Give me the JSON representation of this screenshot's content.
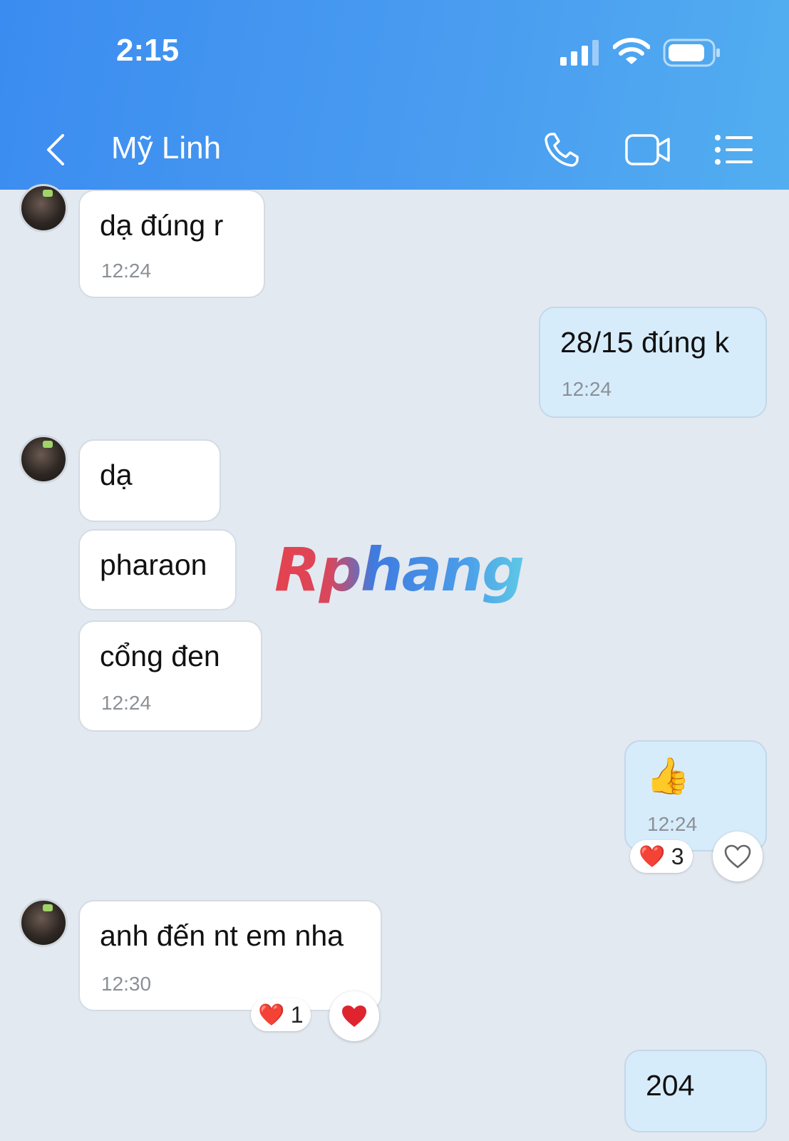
{
  "status_bar": {
    "time": "2:15"
  },
  "header": {
    "contact_name": "Mỹ Linh"
  },
  "messages": [
    {
      "side": "in",
      "text": "dạ đúng r",
      "time": "12:24"
    },
    {
      "side": "out",
      "text": "28/15 đúng k",
      "time": "12:24"
    },
    {
      "side": "in",
      "text": "dạ"
    },
    {
      "side": "in",
      "text": "pharaon"
    },
    {
      "side": "in",
      "text": "cổng đen",
      "time": "12:24"
    },
    {
      "side": "out",
      "text": "👍",
      "time": "12:24",
      "reaction": {
        "emoji": "❤️",
        "count": "3"
      }
    },
    {
      "side": "in",
      "text": "anh đến nt em nha",
      "time": "12:30",
      "reaction": {
        "emoji": "❤️",
        "count": "1"
      }
    },
    {
      "side": "out",
      "text": "204"
    }
  ],
  "watermark": "Rphang",
  "colors": {
    "header": "#3b8cf0",
    "chat_bg": "#e3e9f1",
    "outgoing_bubble": "#d7ecfb",
    "incoming_bubble": "#ffffff",
    "heart": "#e0242f"
  }
}
